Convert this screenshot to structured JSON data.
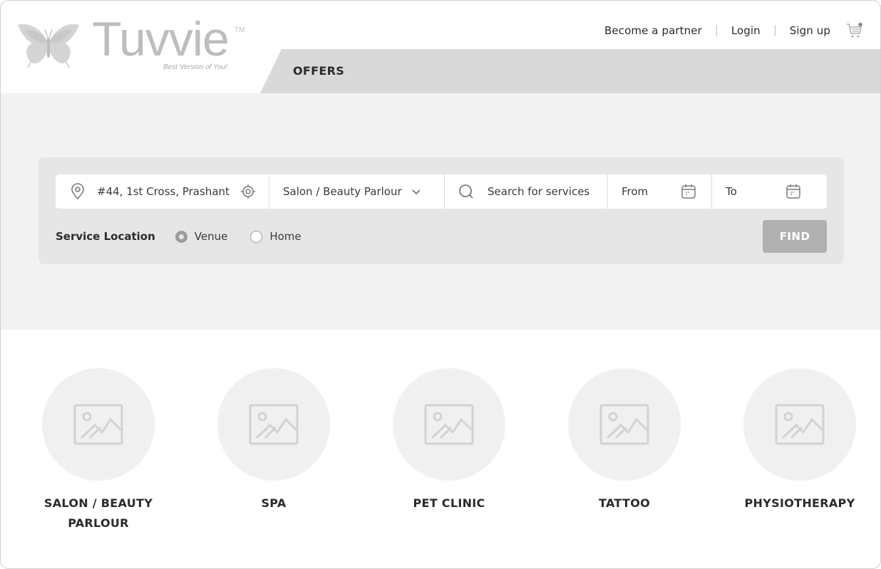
{
  "brand": {
    "name": "Tuvvie",
    "trademark": "TM",
    "tagline": "Best Version of You!",
    "logo_icon": "butterfly-icon"
  },
  "topnav": {
    "links": [
      {
        "label": "Become a partner"
      },
      {
        "label": "Login"
      },
      {
        "label": "Sign up"
      }
    ],
    "cart_icon": "cart-icon"
  },
  "offers_bar": {
    "label": "OFFERS"
  },
  "search": {
    "location": {
      "icon": "map-pin-icon",
      "value": "#44, 1st Cross, Prashant",
      "locate_icon": "crosshair-icon"
    },
    "category": {
      "selected": "Salon / Beauty Parlour",
      "icon": "chevron-down-icon"
    },
    "service": {
      "icon": "search-icon",
      "placeholder": "Search for services"
    },
    "from": {
      "placeholder": "From",
      "icon": "calendar-icon"
    },
    "to": {
      "placeholder": "To",
      "icon": "calendar-icon"
    },
    "service_location": {
      "label": "Service Location",
      "options": [
        {
          "label": "Venue",
          "checked": true
        },
        {
          "label": "Home",
          "checked": false
        }
      ]
    },
    "find_label": "FIND"
  },
  "categories": [
    {
      "label": "SALON / BEAUTY PARLOUR",
      "icon": "image-placeholder-icon"
    },
    {
      "label": "SPA",
      "icon": "image-placeholder-icon"
    },
    {
      "label": "PET CLINIC",
      "icon": "image-placeholder-icon"
    },
    {
      "label": "TATTOO",
      "icon": "image-placeholder-icon"
    },
    {
      "label": "PHYSIOTHERAPY",
      "icon": "image-placeholder-icon"
    }
  ],
  "colors": {
    "hero_bg": "#f2f2f2",
    "panel_bg": "#e6e6e6",
    "offers_bg": "#d9d9d9",
    "find_button": "#b0b0b0",
    "logo_gray": "#bdbdbd"
  }
}
